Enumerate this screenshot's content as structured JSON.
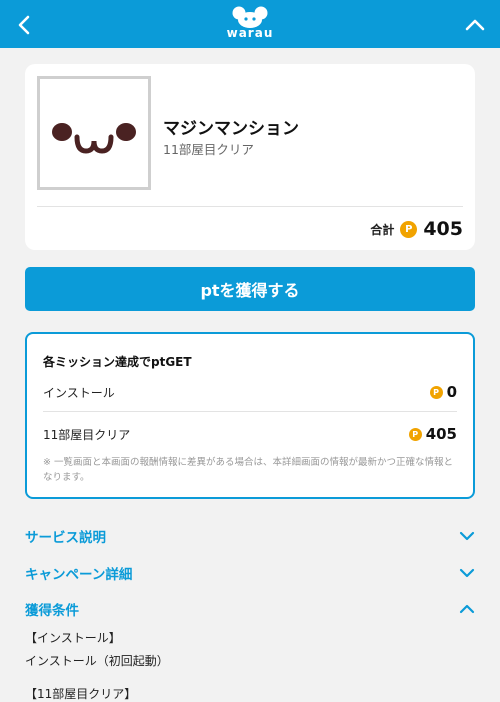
{
  "header": {
    "logo_text": "warau",
    "back_icon": "chevron-left-icon",
    "collapse_icon": "chevron-up-icon",
    "accent": "#0b9bd8"
  },
  "app": {
    "name": "マジンマンション",
    "subtitle": "11部屋目クリア",
    "total_label": "合計",
    "total_points": "405"
  },
  "cta": {
    "label": "ptを獲得する"
  },
  "mission": {
    "title": "各ミッション達成でptGET",
    "rows": [
      {
        "label": "インストール",
        "points": "0"
      },
      {
        "label": "11部屋目クリア",
        "points": "405"
      }
    ],
    "note": "※ 一覧画面と本画面の報酬情報に差異がある場合は、本詳細画面の情報が最新かつ正確な情報となります。"
  },
  "sections": [
    {
      "title": "サービス説明",
      "state": "collapsed"
    },
    {
      "title": "キャンペーン詳細",
      "state": "collapsed"
    },
    {
      "title": "獲得条件",
      "state": "expanded"
    }
  ],
  "conditions": {
    "line1": "【インストール】",
    "line2": "インストール（初回起動）",
    "line3": "【11部屋目クリア】"
  },
  "colors": {
    "accent": "#0b9bd8",
    "coin": "#f1a300",
    "background": "#f2f2f2"
  }
}
